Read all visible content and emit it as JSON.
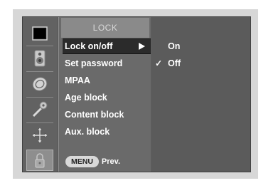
{
  "menu": {
    "title": "LOCK",
    "items": [
      {
        "label": "Lock on/off",
        "active": true
      },
      {
        "label": "Set password"
      },
      {
        "label": "MPAA"
      },
      {
        "label": "Age block"
      },
      {
        "label": "Content block"
      },
      {
        "label": "Aux. block"
      }
    ],
    "footer_button": "MENU",
    "footer_label": "Prev."
  },
  "submenu": {
    "options": [
      {
        "label": "On",
        "checked": false,
        "check_mark": ""
      },
      {
        "label": "Off",
        "checked": true,
        "check_mark": "✓"
      }
    ]
  },
  "icons": [
    {
      "name": "picture-icon",
      "selected": false
    },
    {
      "name": "speaker-icon",
      "selected": false
    },
    {
      "name": "clock-icon",
      "selected": false
    },
    {
      "name": "satellite-icon",
      "selected": false
    },
    {
      "name": "option-icon",
      "selected": false
    },
    {
      "name": "lock-icon",
      "selected": true
    }
  ],
  "colors": {
    "panel": "#5d5d5d",
    "active_row": "#2b2b2b",
    "selected_icon": "#8e8e8e"
  }
}
